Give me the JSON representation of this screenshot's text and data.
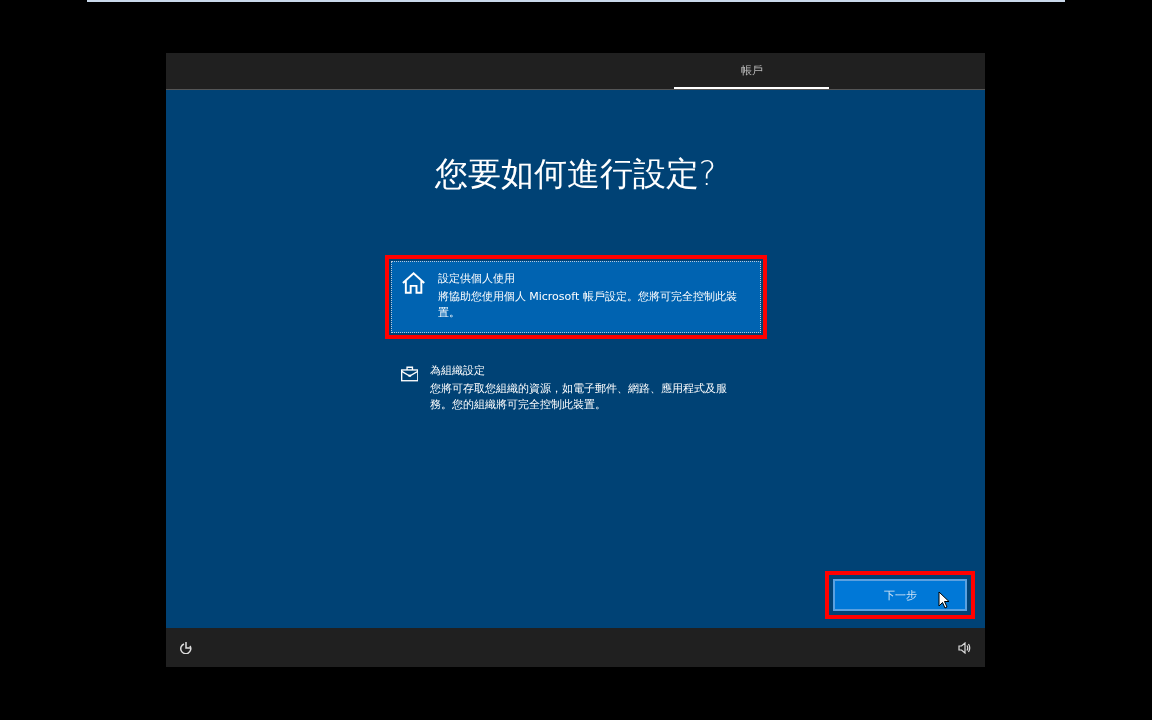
{
  "header": {
    "tabs": [
      {
        "label": "帳戶",
        "selected": true
      }
    ]
  },
  "title": "您要如何進行設定?",
  "options": [
    {
      "kind": "personal",
      "title": "設定供個人使用",
      "description": "將協助您使用個人 Microsoft 帳戶設定。您將可完全控制此裝置。",
      "selected": true,
      "highlighted": true
    },
    {
      "kind": "organization",
      "title": "為組織設定",
      "description": "您將可存取您組織的資源，如電子郵件、網路、應用程式及服務。您的組織將可完全控制此裝置。",
      "selected": false,
      "highlighted": false
    }
  ],
  "next_button": {
    "label": "下一步",
    "highlighted": true
  }
}
